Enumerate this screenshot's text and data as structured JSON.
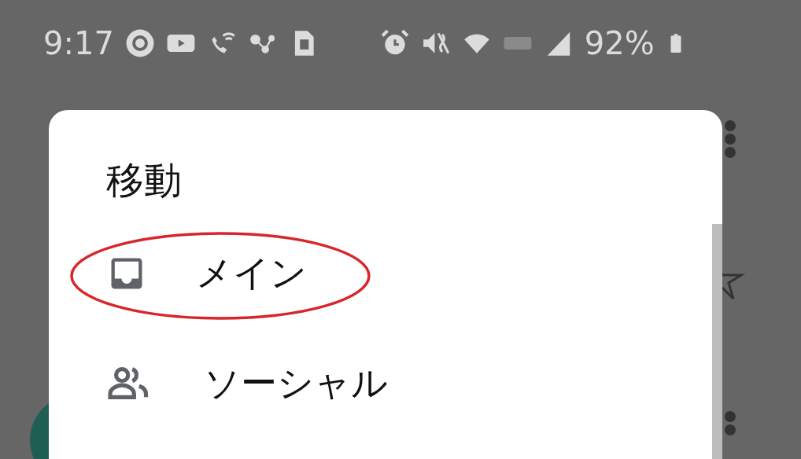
{
  "status_bar": {
    "time": "9:17",
    "battery": "92%"
  },
  "dialog": {
    "title": "移動",
    "items": [
      {
        "kind": "inbox",
        "label": "メイン",
        "circled": true
      },
      {
        "kind": "people",
        "label": "ソーシャル",
        "circled": false
      }
    ]
  }
}
